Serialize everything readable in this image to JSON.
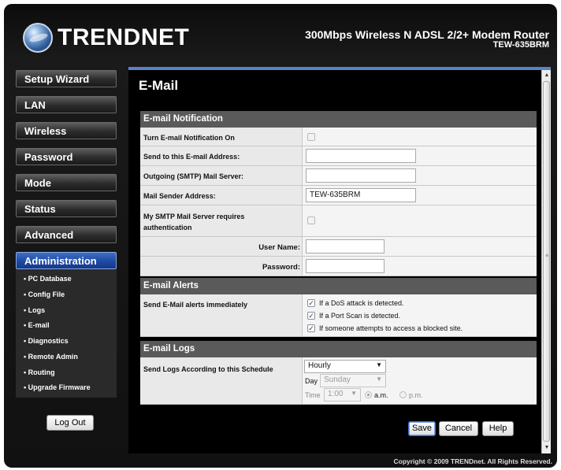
{
  "header": {
    "logo_text": "TRENDNET",
    "product_line": "300Mbps Wireless N ADSL 2/2+ Modem Router",
    "product_model": "TEW-635BRM"
  },
  "sidebar": {
    "items": [
      {
        "label": "Setup Wizard"
      },
      {
        "label": "LAN"
      },
      {
        "label": "Wireless"
      },
      {
        "label": "Password"
      },
      {
        "label": "Mode"
      },
      {
        "label": "Status"
      },
      {
        "label": "Advanced"
      },
      {
        "label": "Administration",
        "active": true
      }
    ],
    "submenu": [
      "• PC Database",
      "• Config File",
      "• Logs",
      "• E-mail",
      "• Diagnostics",
      "• Remote Admin",
      "• Routing",
      "• Upgrade Firmware"
    ],
    "logout_label": "Log Out"
  },
  "page": {
    "title": "E-Mail",
    "notification": {
      "header": "E-mail Notification",
      "turn_on_label": "Turn E-mail Notification On",
      "turn_on_checked": false,
      "send_to_label": "Send to this E-mail Address:",
      "send_to_value": "",
      "smtp_server_label": "Outgoing (SMTP) Mail Server:",
      "smtp_server_value": "",
      "sender_label": "Mail Sender Address:",
      "sender_value": "TEW-635BRM",
      "auth_label_line1": "My SMTP Mail Server requires",
      "auth_label_line2": "authentication",
      "auth_checked": false,
      "username_label": "User Name:",
      "username_value": "",
      "password_label": "Password:",
      "password_value": ""
    },
    "alerts": {
      "header": "E-mail Alerts",
      "label": "Send E-Mail alerts immediately",
      "options": [
        {
          "text": "If a DoS attack is detected.",
          "checked": true
        },
        {
          "text": "If a Port Scan is detected.",
          "checked": true
        },
        {
          "text": "If someone attempts to access a blocked site.",
          "checked": true
        }
      ]
    },
    "logs": {
      "header": "E-mail Logs",
      "label": "Send Logs According to this Schedule",
      "schedule_value": "Hourly",
      "day_label": "Day",
      "day_value": "Sunday",
      "time_label": "Time",
      "time_value": "1:00",
      "am_label": "a.m.",
      "pm_label": "p.m.",
      "am_checked": true
    },
    "buttons": {
      "save": "Save",
      "cancel": "Cancel",
      "help": "Help"
    },
    "copyright": "Copyright © 2009 TRENDnet. All Rights Reserved."
  },
  "colors": {
    "accent": "#5b82c9",
    "active_nav": "#1c46a2",
    "section_header": "#5a5a5a",
    "background": "#000000"
  }
}
